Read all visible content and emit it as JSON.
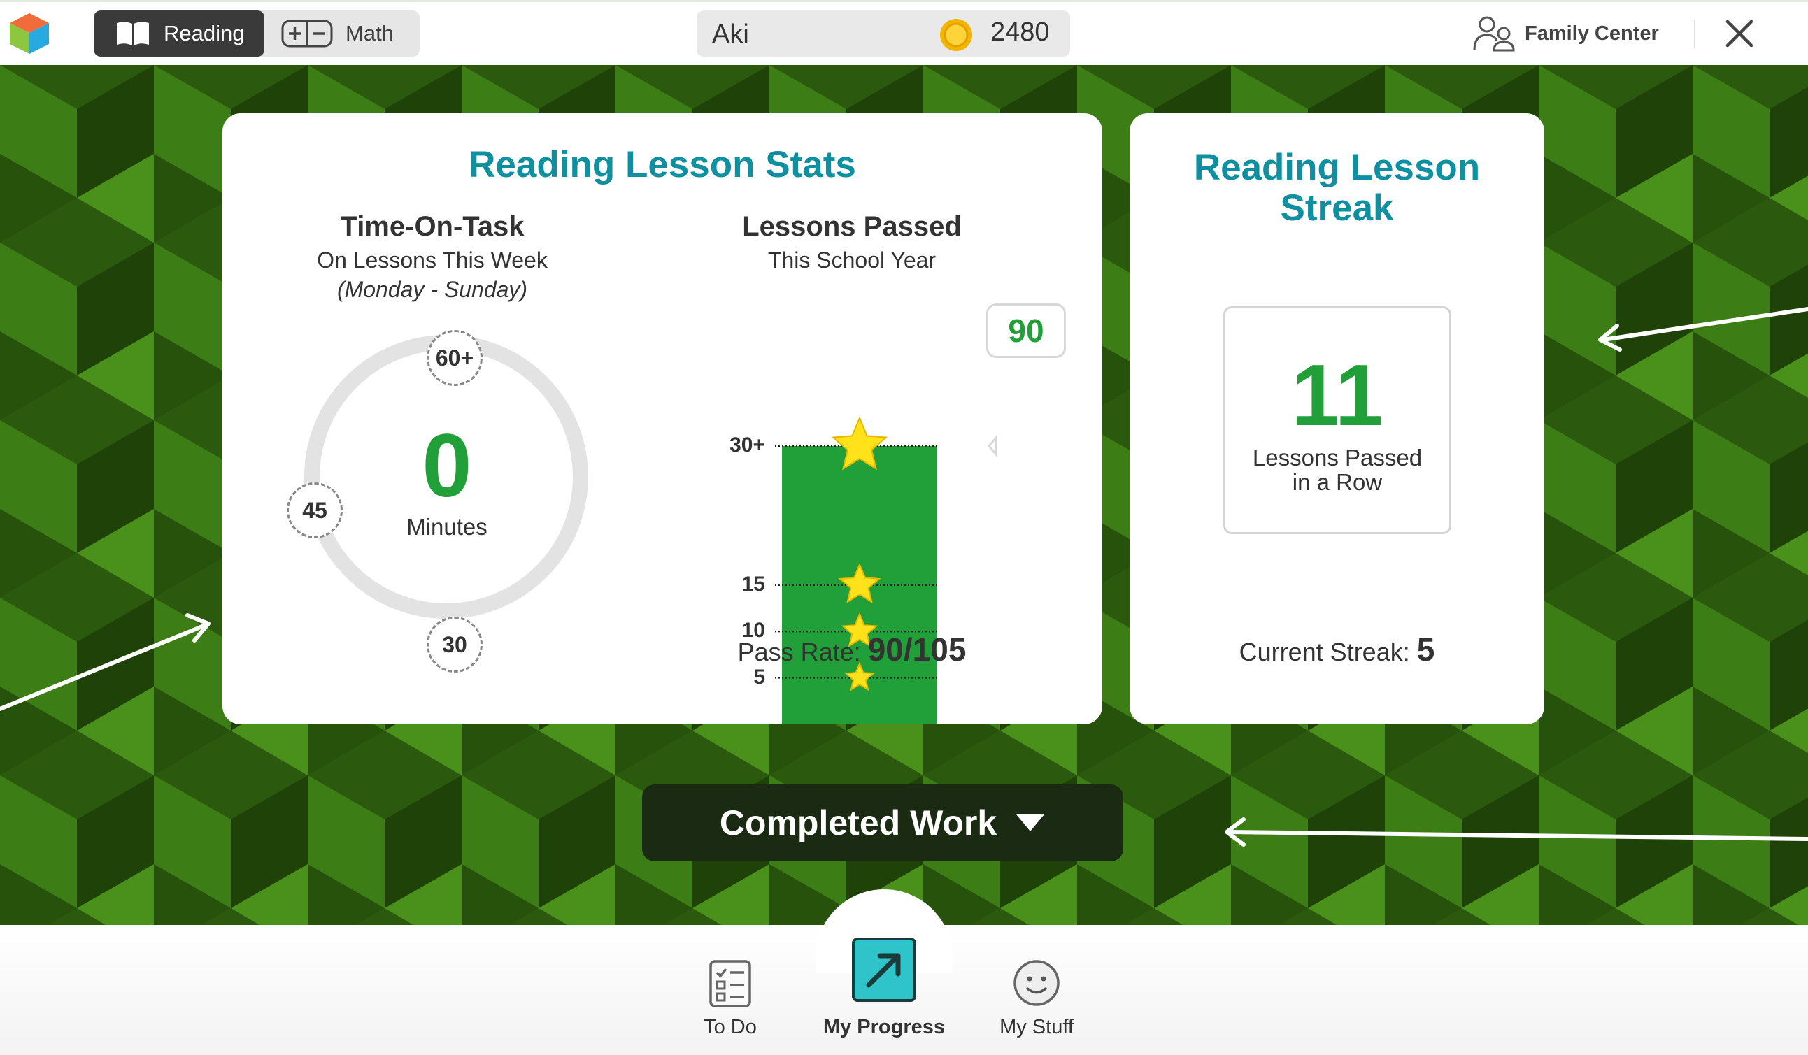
{
  "topbar": {
    "tabs": [
      {
        "label": "Reading",
        "icon": "open-book-icon",
        "active": true
      },
      {
        "label": "Math",
        "icon": "plus-minus-icon",
        "active": false
      }
    ],
    "user_name": "Aki",
    "coin_count": "2480",
    "family_center_label": "Family Center"
  },
  "stats_card": {
    "title": "Reading Lesson Stats",
    "time_on_task": {
      "heading": "Time-On-Task",
      "subtitle": "On Lessons This Week",
      "range": "(Monday - Sunday)",
      "value": "0",
      "unit": "Minutes",
      "markers": [
        "60+",
        "45",
        "30"
      ],
      "progress_fraction": 0
    },
    "lessons_passed": {
      "heading": "Lessons Passed",
      "subtitle": "This School Year",
      "count": "90",
      "pass_rate_label": "Pass Rate:",
      "pass_rate_value": "90/105"
    }
  },
  "streak_card": {
    "title_line1": "Reading Lesson",
    "title_line2": "Streak",
    "best_streak": "11",
    "best_label_line1": "Lessons Passed",
    "best_label_line2": "in a Row",
    "current_label": "Current Streak:",
    "current_value": "5"
  },
  "completed_work_label": "Completed Work",
  "bottom_nav": [
    {
      "label": "To Do",
      "icon": "checklist-icon",
      "active": false
    },
    {
      "label": "My Progress",
      "icon": "progress-arrow-icon",
      "active": true
    },
    {
      "label": "My Stuff",
      "icon": "smiley-icon",
      "active": false
    }
  ],
  "colors": {
    "title_teal": "#0f8fa0",
    "accent_green": "#21a03a",
    "star_yellow": "#ffe21a",
    "background_green": "#2f6410"
  },
  "chart_data": {
    "type": "bar",
    "categories": [
      "Lessons Passed"
    ],
    "values": [
      90
    ],
    "ticks": [
      {
        "value": 5,
        "label": "5"
      },
      {
        "value": 10,
        "label": "10"
      },
      {
        "value": 15,
        "label": "15"
      },
      {
        "value": 30,
        "label": "30+"
      }
    ],
    "ylim": [
      0,
      30
    ]
  }
}
